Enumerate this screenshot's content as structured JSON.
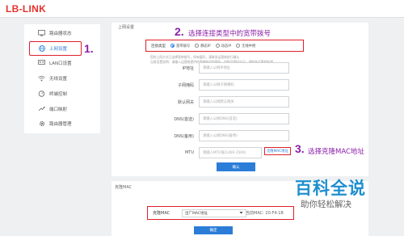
{
  "brand": {
    "logo": "LB-LINK"
  },
  "sidebar": {
    "items": [
      {
        "label": "路由器状态",
        "icon": "monitor-icon"
      },
      {
        "label": "上网设置",
        "icon": "globe-icon",
        "active": true
      },
      {
        "label": "LAN口设置",
        "icon": "lan-icon"
      },
      {
        "label": "无线设置",
        "icon": "wifi-icon"
      },
      {
        "label": "终端控制",
        "icon": "device-control-icon"
      },
      {
        "label": "端口映射",
        "icon": "port-mapping-icon"
      },
      {
        "label": "路由器管理",
        "icon": "gear-icon"
      }
    ]
  },
  "internet": {
    "section_title": "上网设置",
    "type_label": "连接类型",
    "options": [
      "宽带拨号",
      "静态IP",
      "动态IP",
      "无线中继"
    ],
    "selected_option": "宽带拨号",
    "hint_line1": "您的上网方式已选择宽带拨号，如有疑问，请联系运营商进行确认",
    "hint_line2": "当前设置说明：请输入运营商提供的宽带账号和密码，如账号密码忘记，请联系运营商处理",
    "fields": [
      {
        "label": "IP地址",
        "placeholder": "请输入公网IP地址"
      },
      {
        "label": "子网掩码",
        "placeholder": "请输入公网子网掩码"
      },
      {
        "label": "默认网关",
        "placeholder": "请输入公网默认网关"
      },
      {
        "label": "DNS(首选)",
        "placeholder": "请输入公网DNS(首选)"
      },
      {
        "label": "DNS(备用)",
        "placeholder": "请输入公网DNS(备用)"
      },
      {
        "label": "MTU",
        "placeholder": "请输入MTU值(1400-1500)"
      }
    ],
    "clone_mac_link": "克隆MAC地址",
    "confirm_button": "确认"
  },
  "clone_mac": {
    "section_title": "克隆MAC",
    "label": "克隆MAC",
    "selected": "出厂MAC地址",
    "current_mac": "当前MAC: 20:F4:1B",
    "confirm_button": "确定"
  },
  "annotations": {
    "step1_number": "1.",
    "step2_number": "2.",
    "step2_text": "选择连接类型中的宽带拨号",
    "step3_number": "3.",
    "step3_text": "选择克隆MAC地址"
  },
  "watermark": {
    "title": "百科全说",
    "subtitle": "助你轻松解决"
  },
  "colors": {
    "accent": "#2b7dd8",
    "annotation": "#8b1fa8",
    "highlight": "#e0202a",
    "logo": "#e5322d",
    "watermark": "#1e8fce"
  }
}
